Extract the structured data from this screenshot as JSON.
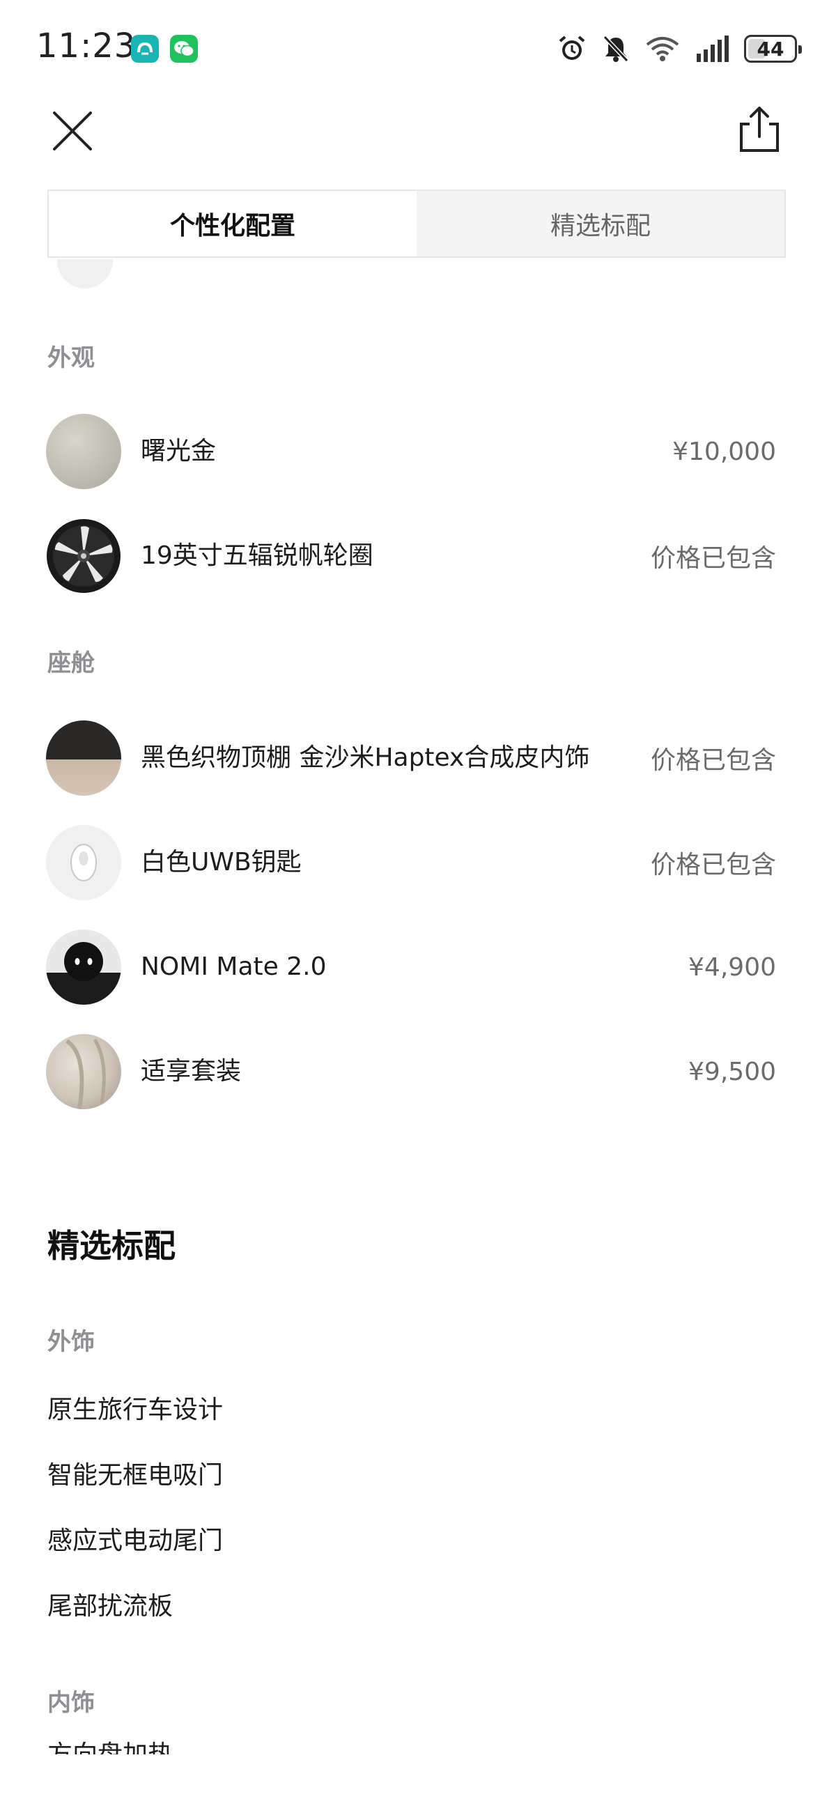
{
  "status_bar": {
    "time": "11:23",
    "battery": "44",
    "battery_level": 0.44,
    "icons": [
      "nio-app-icon",
      "wechat-icon",
      "alarm-icon",
      "mute-bell-icon",
      "wifi-icon",
      "signal-icon",
      "battery-icon"
    ]
  },
  "nav": {
    "close_icon": "close-icon",
    "share_icon": "share-icon"
  },
  "tabs": [
    {
      "label": "个性化配置",
      "active": true
    },
    {
      "label": "精选标配",
      "active": false
    }
  ],
  "personalized": {
    "exterior": {
      "title": "外观",
      "items": [
        {
          "name": "曙光金",
          "price": "¥10,000"
        },
        {
          "name": "19英寸五辐锐帆轮圈",
          "price": "价格已包含"
        }
      ]
    },
    "cabin": {
      "title": "座舱",
      "items": [
        {
          "name": "黑色织物顶棚 金沙米Haptex合成皮内饰",
          "price": "价格已包含"
        },
        {
          "name": "白色UWB钥匙",
          "price": "价格已包含"
        },
        {
          "name": "NOMI Mate 2.0",
          "price": "¥4,900"
        },
        {
          "name": "适享套装",
          "price": "¥9,500"
        }
      ]
    }
  },
  "standard": {
    "heading": "精选标配",
    "exterior_trim": {
      "title": "外饰",
      "items": [
        "原生旅行车设计",
        "智能无框电吸门",
        "感应式电动尾门",
        "尾部扰流板"
      ]
    },
    "interior_trim": {
      "title": "内饰",
      "partial_item": "方向盘加热"
    }
  },
  "colors": {
    "accent_gold": "#c0bdb2",
    "nio_teal": "#19b5b4",
    "wechat_green": "#1fc25c"
  }
}
